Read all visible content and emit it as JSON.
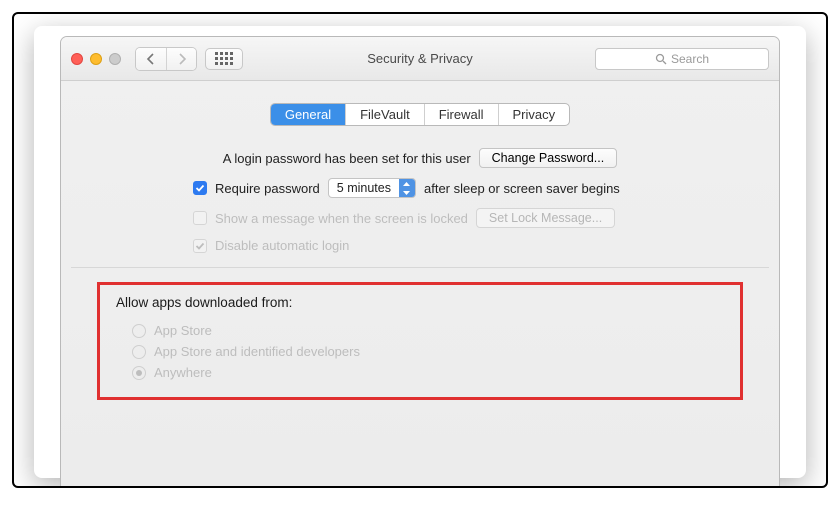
{
  "window": {
    "title": "Security & Privacy",
    "search_placeholder": "Search"
  },
  "tabs": [
    {
      "label": "General",
      "active": true
    },
    {
      "label": "FileVault",
      "active": false
    },
    {
      "label": "Firewall",
      "active": false
    },
    {
      "label": "Privacy",
      "active": false
    }
  ],
  "login_section": {
    "password_set_label": "A login password has been set for this user",
    "change_password_label": "Change Password...",
    "require_checkbox_label": "Require password",
    "require_checkbox_checked": true,
    "delay_value": "5 minutes",
    "after_label": "after sleep or screen saver begins",
    "show_message_label": "Show a message when the screen is locked",
    "show_message_checked": false,
    "set_lock_message_label": "Set Lock Message...",
    "disable_auto_login_label": "Disable automatic login",
    "disable_auto_login_checked": true
  },
  "allow_apps": {
    "title": "Allow apps downloaded from:",
    "options": [
      {
        "label": "App Store",
        "selected": false
      },
      {
        "label": "App Store and identified developers",
        "selected": false
      },
      {
        "label": "Anywhere",
        "selected": true
      }
    ]
  }
}
